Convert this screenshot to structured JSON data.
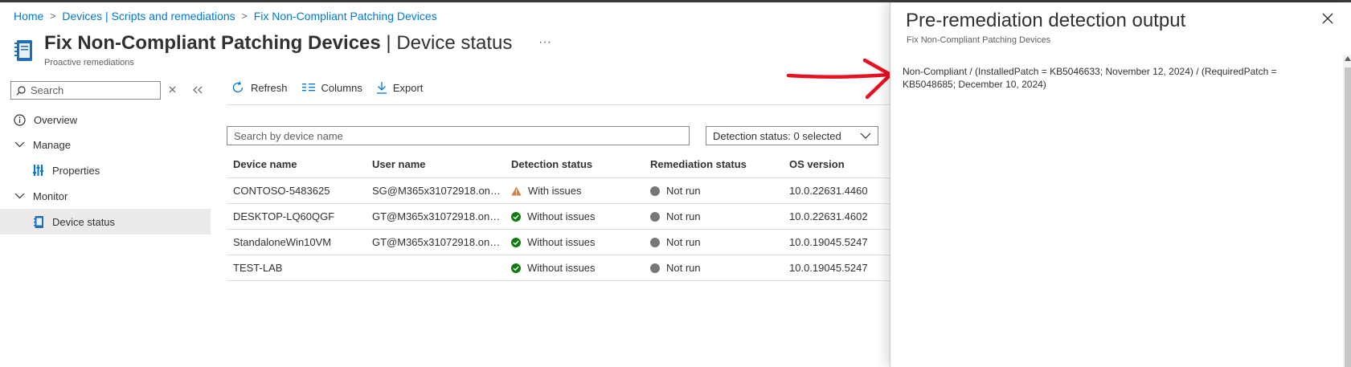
{
  "breadcrumb": {
    "home": "Home",
    "devices": "Devices | Scripts and remediations",
    "current": "Fix Non-Compliant Patching Devices",
    "separator": ">"
  },
  "header": {
    "title": "Fix Non-Compliant Patching Devices",
    "divider": "|",
    "page": "Device status",
    "more": "···",
    "subtitle": "Proactive remediations"
  },
  "nav": {
    "search_placeholder": "Search",
    "clear_icon": "close-icon",
    "collapse_icon": "double-chevron-left-icon",
    "items": [
      {
        "label": "Overview",
        "icon": "info-icon"
      },
      {
        "label": "Manage",
        "icon": "chevron-down-icon"
      },
      {
        "label": "Properties",
        "icon": "properties-icon"
      },
      {
        "label": "Monitor",
        "icon": "chevron-down-icon"
      },
      {
        "label": "Device status",
        "icon": "device-status-icon",
        "selected": true
      }
    ]
  },
  "toolbar": {
    "refresh": "Refresh",
    "columns": "Columns",
    "export": "Export"
  },
  "filters": {
    "device_search_placeholder": "Search by device name",
    "detection_status": "Detection status: 0 selected"
  },
  "table": {
    "columns": [
      "Device name",
      "User name",
      "Detection status",
      "Remediation status",
      "OS version"
    ],
    "rows": [
      {
        "device": "CONTOSO-5483625",
        "user": "SG@M365x31072918.onmi...",
        "detection": "With issues",
        "detection_icon": "warning-icon",
        "remediation": "Not run",
        "os": "10.0.22631.4460"
      },
      {
        "device": "DESKTOP-LQ60QGF",
        "user": "GT@M365x31072918.onmi...",
        "detection": "Without issues",
        "detection_icon": "check-circle-icon",
        "remediation": "Not run",
        "os": "10.0.22631.4602"
      },
      {
        "device": "StandaloneWin10VM",
        "user": "GT@M365x31072918.onmi...",
        "detection": "Without issues",
        "detection_icon": "check-circle-icon",
        "remediation": "Not run",
        "os": "10.0.19045.5247"
      },
      {
        "device": "TEST-LAB",
        "user": "",
        "detection": "Without issues",
        "detection_icon": "check-circle-icon",
        "remediation": "Not run",
        "os": "10.0.19045.5247"
      }
    ]
  },
  "panel": {
    "title": "Pre-remediation detection output",
    "subtitle": "Fix Non-Compliant Patching Devices",
    "output": "Non-Compliant / (InstalledPatch = KB5046633; November 12, 2024) / (RequiredPatch = KB5048685; December 10, 2024)"
  },
  "colors": {
    "link": "#0078d4",
    "warning": "#d67f3c",
    "success": "#107c10",
    "neutral_dot": "#797775",
    "annotation_arrow": "#e81123",
    "selected_bg": "#edebe9"
  }
}
